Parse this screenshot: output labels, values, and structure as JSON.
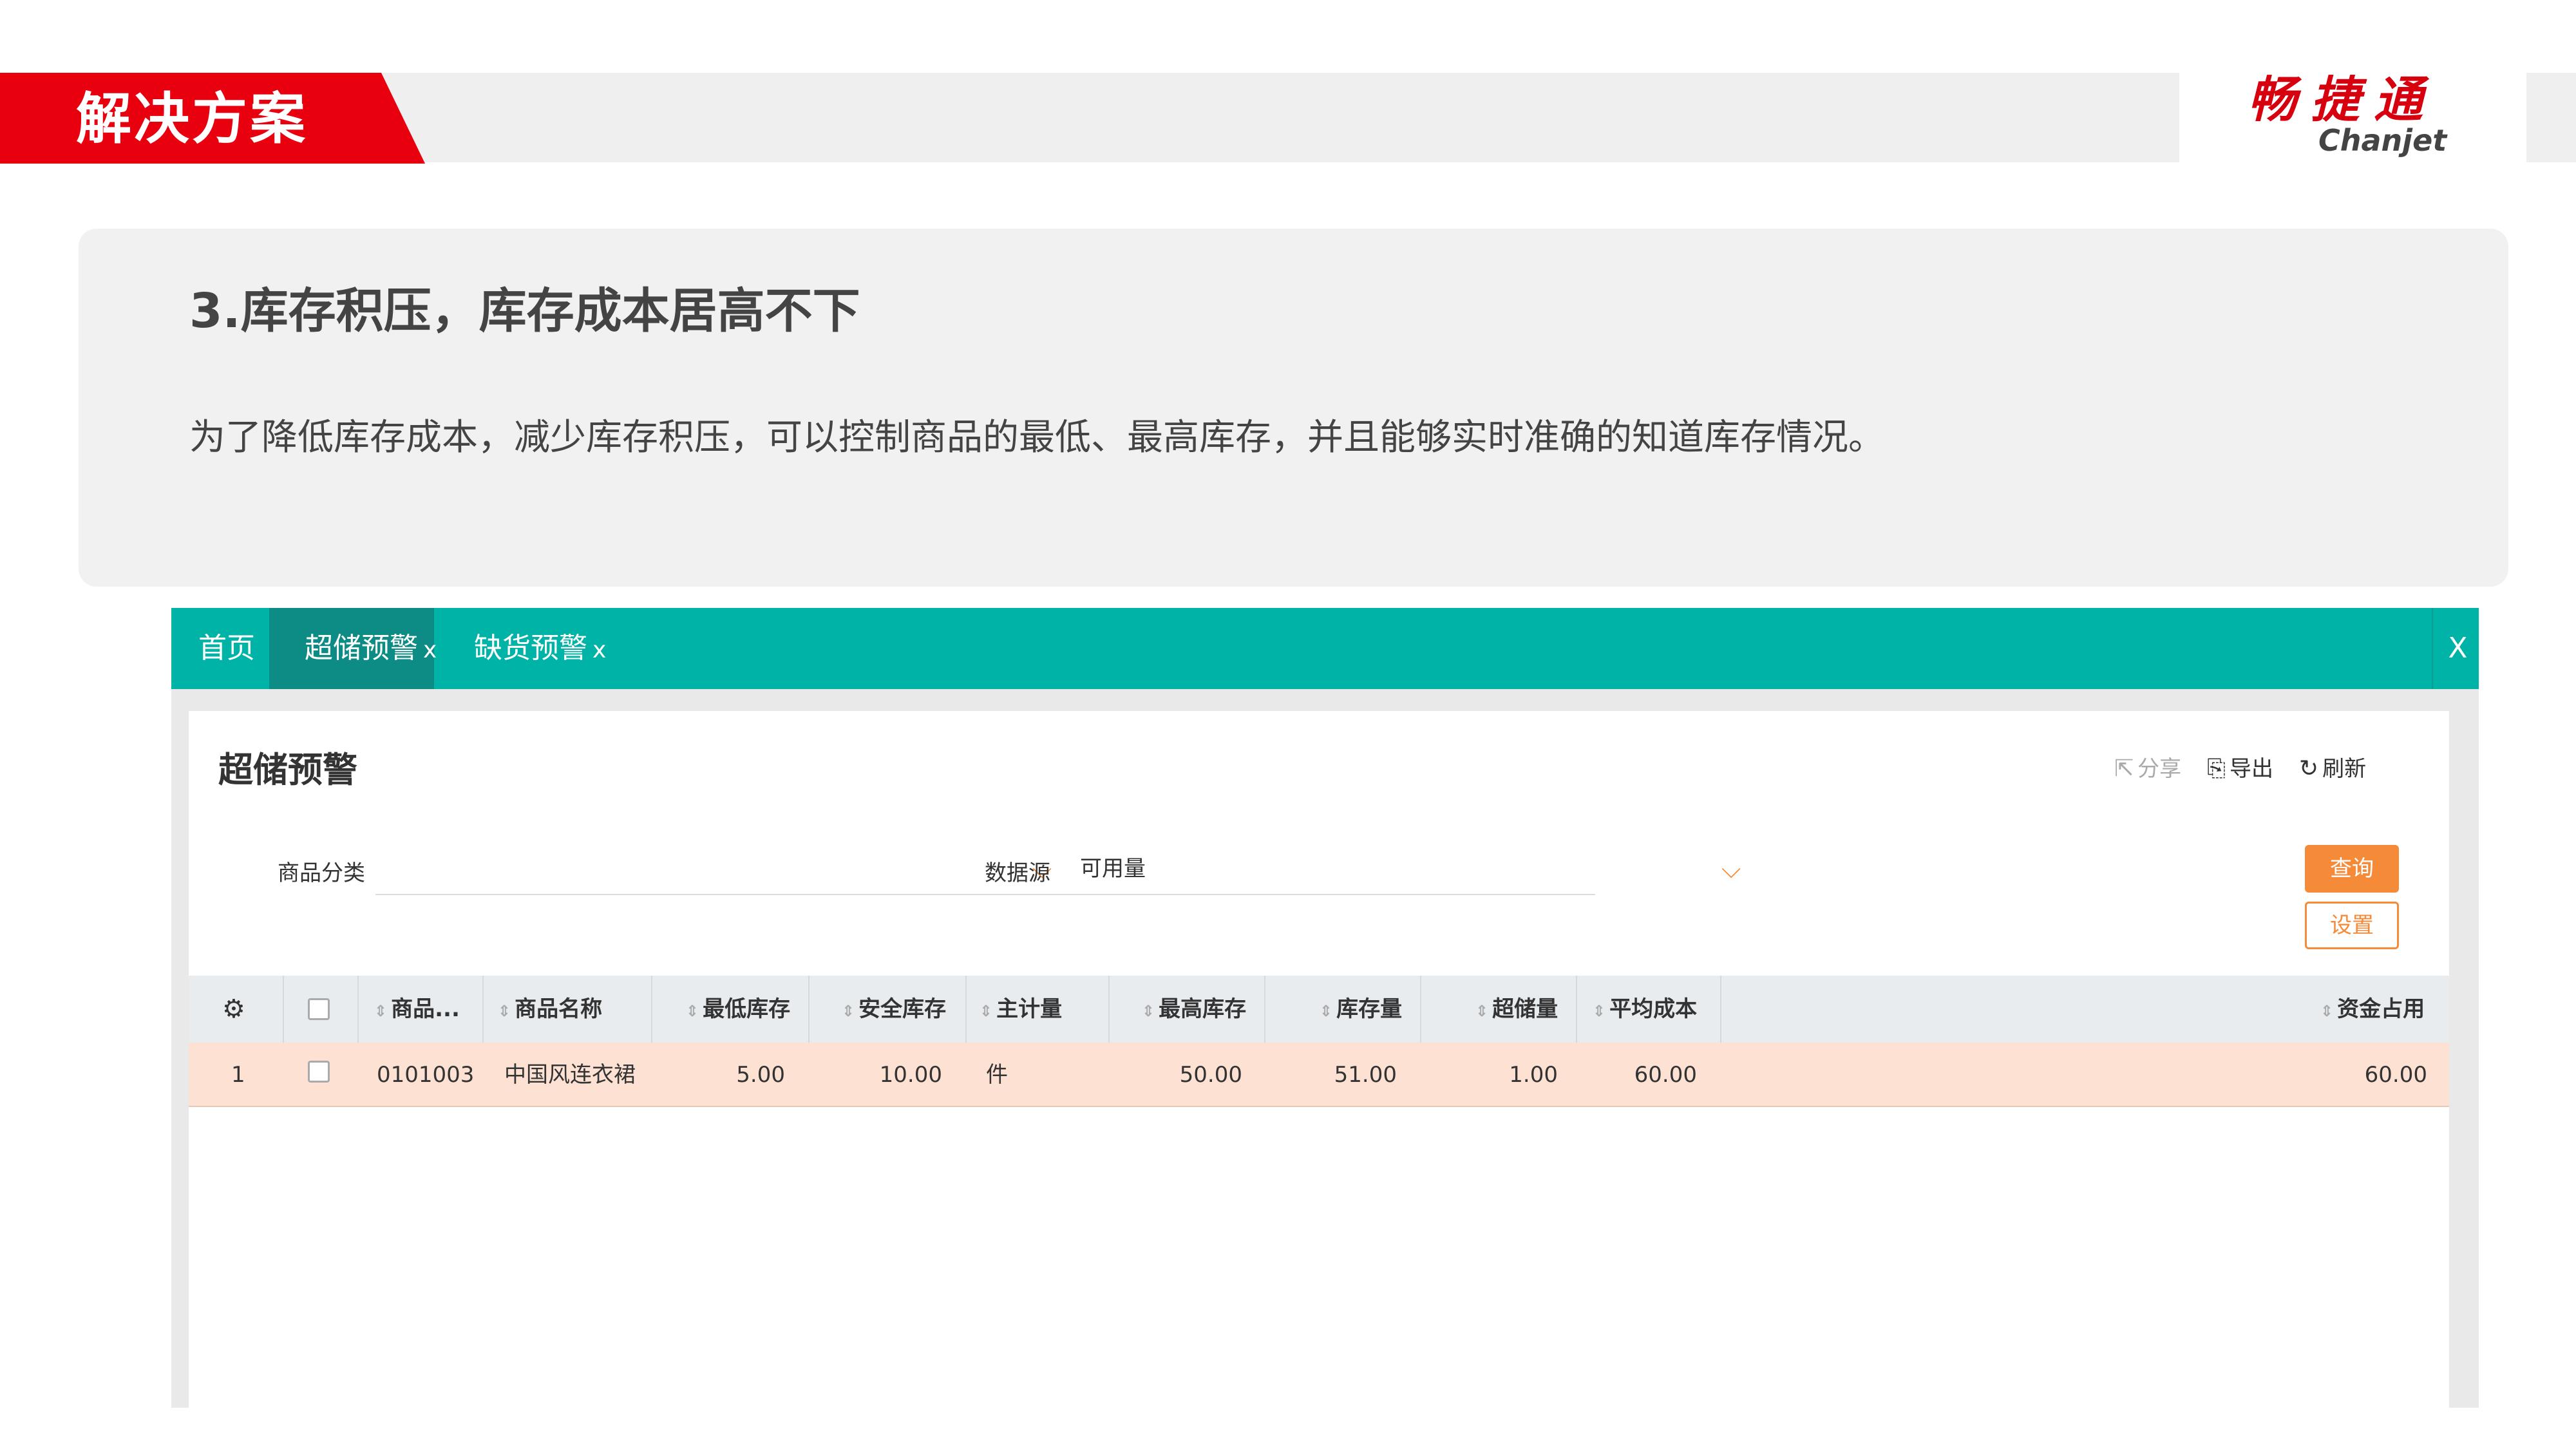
{
  "slide": {
    "section_title": "解决方案",
    "logo_cn": "畅捷通",
    "logo_en": "Chanjet",
    "card_title": "3.库存积压，库存成本居高不下",
    "card_text": "为了降低库存成本，减少库存积压，可以控制商品的最低、最高库存，并且能够实时准确的知道库存情况。"
  },
  "app": {
    "tabs": [
      {
        "label": "首页"
      },
      {
        "label": "超储预警",
        "close": "x"
      },
      {
        "label": "缺货预警",
        "close": "x"
      }
    ],
    "close_all": "X",
    "page_title": "超储预警",
    "toolbar": {
      "share": "分享",
      "export": "导出",
      "refresh": "刷新"
    },
    "filters": {
      "category_label": "商品分类",
      "category_value": "",
      "source_label": "数据源",
      "source_value": "可用量"
    },
    "buttons": {
      "query": "查询",
      "setting": "设置"
    },
    "table": {
      "columns": [
        "商品...",
        "商品名称",
        "最低库存",
        "安全库存",
        "主计量",
        "最高库存",
        "库存量",
        "超储量",
        "平均成本",
        "资金占用"
      ],
      "rows": [
        {
          "index": "1",
          "code": "0101003",
          "name": "中国风连衣裙",
          "min_stock": "5.00",
          "safe_stock": "10.00",
          "unit": "件",
          "max_stock": "50.00",
          "stock": "51.00",
          "over_stock": "1.00",
          "avg_cost": "60.00",
          "capital": "60.00"
        }
      ]
    }
  },
  "colors": {
    "brand_red": "#e8000e",
    "tab_teal": "#00b3a7",
    "accent_orange": "#f58b38",
    "row_highlight": "#fde2d3"
  }
}
